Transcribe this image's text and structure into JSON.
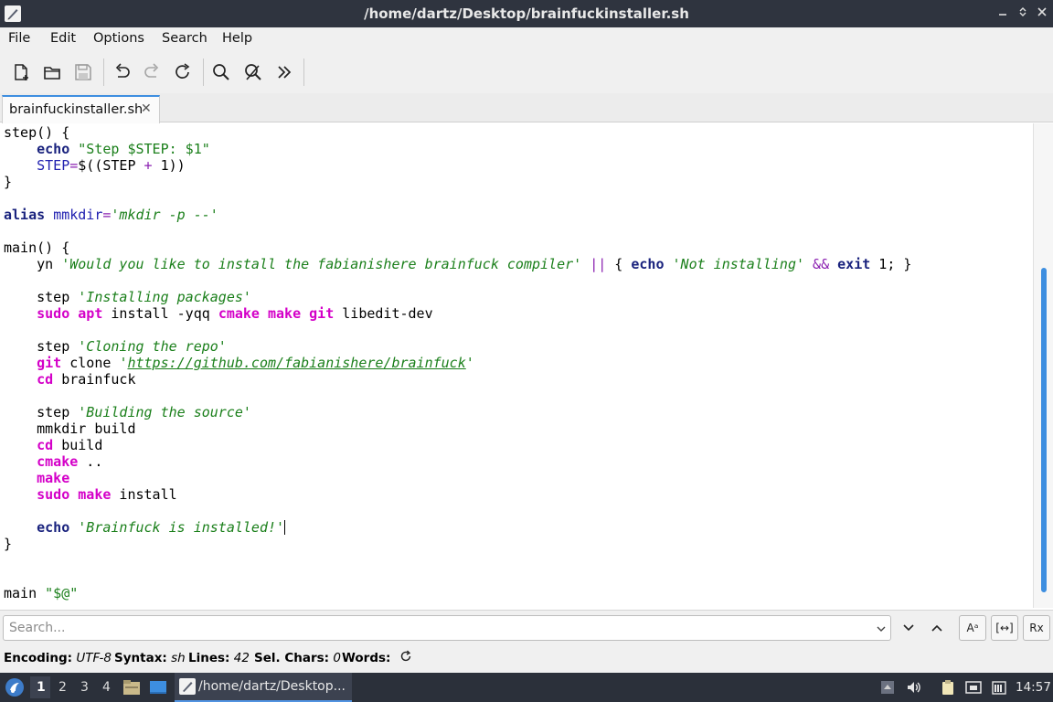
{
  "window": {
    "title": "/home/dartz/Desktop/brainfuckinstaller.sh",
    "controls": [
      "minimize",
      "maximize",
      "close"
    ]
  },
  "menu": [
    "File",
    "Edit",
    "Options",
    "Search",
    "Help"
  ],
  "toolbar": {
    "buttons": [
      "new-file-icon",
      "open-folder-icon",
      "save-icon",
      "undo-icon",
      "redo-icon",
      "reload-icon",
      "find-icon",
      "find-replace-icon",
      "more-icon"
    ]
  },
  "tab": {
    "label": "brainfuckinstaller.sh",
    "close": "✕"
  },
  "editor": {
    "lines": [
      "step() {",
      "    echo \"Step $STEP: $1\"",
      "    STEP=$((STEP + 1))",
      "}",
      "",
      "alias mmkdir='mkdir -p --'",
      "",
      "main() {",
      "    yn 'Would you like to install the fabianishere brainfuck compiler' || { echo 'Not installing' && exit 1; }",
      "",
      "    step 'Installing packages'",
      "    sudo apt install -yqq cmake make git libedit-dev",
      "",
      "    step 'Cloning the repo'",
      "    git clone 'https://github.com/fabianishere/brainfuck'",
      "    cd brainfuck",
      "",
      "    step 'Building the source'",
      "    mmkdir build",
      "    cd build",
      "    cmake ..",
      "    make",
      "    sudo make install",
      "",
      "    echo 'Brainfuck is installed!'",
      "}",
      "",
      "",
      "main \"$@\""
    ]
  },
  "search": {
    "placeholder": "Search...",
    "value": "",
    "options": [
      "Aᵃ",
      "[↔]",
      "Rx"
    ]
  },
  "status": {
    "encoding_label": "Encoding:",
    "encoding_value": "UTF-8",
    "syntax_label": "Syntax:",
    "syntax_value": "sh",
    "lines_label": "Lines:",
    "lines_value": "42",
    "selchars_label": "Sel. Chars:",
    "selchars_value": "0",
    "words_label": "Words:"
  },
  "taskbar": {
    "workspaces": [
      "1",
      "2",
      "3",
      "4"
    ],
    "active_workspace": "1",
    "task_label": "/home/dartz/Desktop...",
    "clock": "14:57"
  },
  "colors": {
    "keyword": "#1a237e",
    "command": "#d400c8",
    "string": "#1a7f1a",
    "accent": "#3d8ee0",
    "titlebar": "#2f343f",
    "taskbar": "#2b303a"
  }
}
